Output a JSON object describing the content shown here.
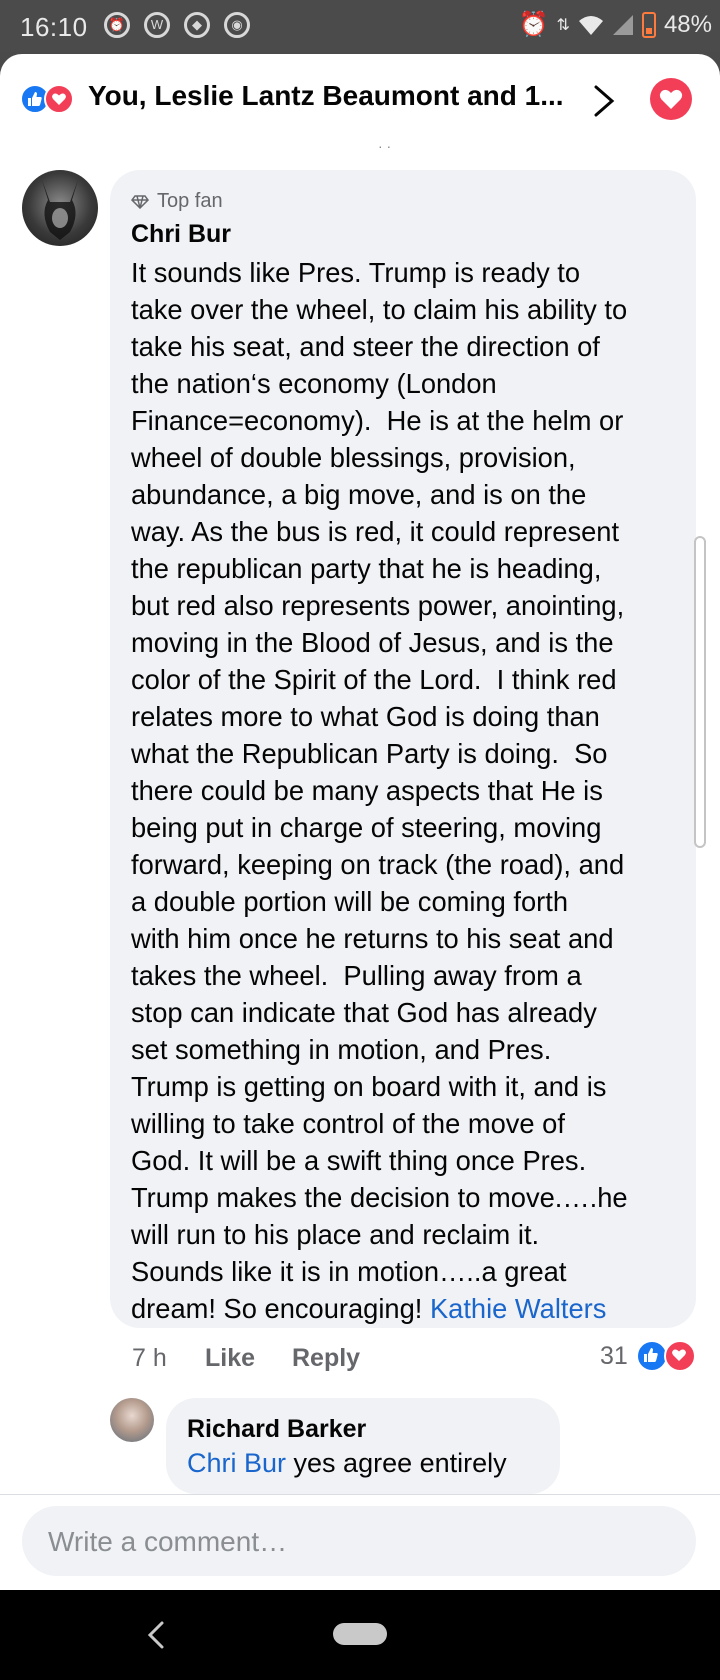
{
  "status_bar": {
    "time": "16:10",
    "battery": "48%",
    "left_icons": [
      "alarm-icon",
      "wordpress-icon",
      "diamond-app-icon",
      "chrome-icon"
    ],
    "right_icons": [
      "alarm-icon",
      "data-arrows-icon",
      "wifi-icon",
      "signal-icon",
      "battery-charging-icon"
    ]
  },
  "header": {
    "title": "You, Leslie Lantz Beaumont and 1...",
    "reactions": [
      "like",
      "love"
    ],
    "accent": "#1877f2",
    "love_color": "#f33e58"
  },
  "comment": {
    "badge": "Top fan",
    "author": "Chri Bur",
    "text": "It sounds like Pres. Trump is ready to\ntake over the wheel, to claim his ability to\ntake his seat, and steer the direction of\nthe nation‘s economy (London\nFinance=economy).  He is at the helm or\nwheel of double blessings, provision,\nabundance, a big move, and is on the\nway. As the bus is red, it could represent\nthe republican party that he is heading,\nbut red also represents power, anointing,\nmoving in the Blood of Jesus, and is the\ncolor of the Spirit of the Lord.  I think red\nrelates more to what God is doing than\nwhat the Republican Party is doing.  So\nthere could be many aspects that He is\nbeing put in charge of steering, moving\nforward, keeping on track (the road), and\na double portion will be coming forth\nwith him once he returns to his seat and\ntakes the wheel.  Pulling away from a\nstop can indicate that God has already\nset something in motion, and Pres.\nTrump is getting on board with it, and is\nwilling to take control of the move of\nGod. It will be a swift thing once Pres.\nTrump makes the decision to move.….he\nwill run to his place and reclaim it.\nSounds like it is in motion…..a great\ndream! So encouraging! ",
    "mention": "Kathie Walters",
    "time": "7 h",
    "like_label": "Like",
    "reply_label": "Reply",
    "reaction_count": "31"
  },
  "reply": {
    "author": "Richard Barker",
    "mention": "Chri Bur",
    "text": " yes agree entirely"
  },
  "composer": {
    "placeholder": "Write a comment…"
  }
}
